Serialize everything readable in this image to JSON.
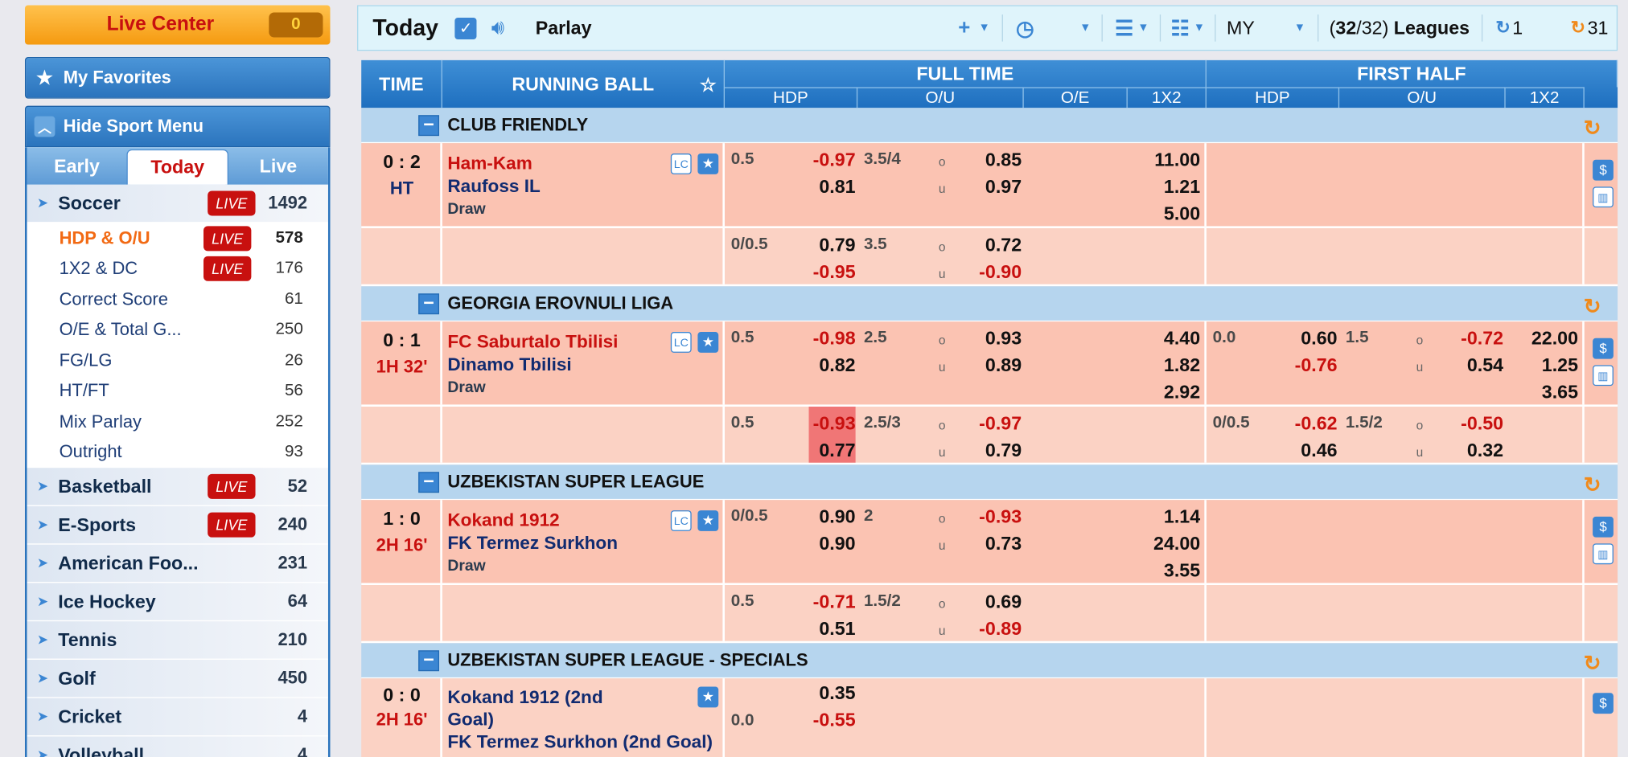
{
  "live_center": {
    "label": "Live Center",
    "count": "0"
  },
  "favorites": {
    "label": "My Favorites"
  },
  "hide_menu": {
    "label": "Hide Sport Menu"
  },
  "tabs": [
    "Early",
    "Today",
    "Live"
  ],
  "live_badge": "LIVE",
  "soccer": {
    "name": "Soccer",
    "count": "1492"
  },
  "subs": [
    {
      "name": "HDP & O/U",
      "count": "578",
      "live": true
    },
    {
      "name": "1X2 & DC",
      "count": "176",
      "live": true
    },
    {
      "name": "Correct Score",
      "count": "61"
    },
    {
      "name": "O/E & Total G...",
      "count": "250"
    },
    {
      "name": "FG/LG",
      "count": "26"
    },
    {
      "name": "HT/FT",
      "count": "56"
    },
    {
      "name": "Mix Parlay",
      "count": "252"
    },
    {
      "name": "Outright",
      "count": "93"
    }
  ],
  "sports": [
    {
      "name": "Basketball",
      "count": "52",
      "live": true
    },
    {
      "name": "E-Sports",
      "count": "240",
      "live": true
    },
    {
      "name": "American Foo...",
      "count": "231"
    },
    {
      "name": "Ice Hockey",
      "count": "64"
    },
    {
      "name": "Tennis",
      "count": "210"
    },
    {
      "name": "Golf",
      "count": "450"
    },
    {
      "name": "Cricket",
      "count": "4"
    },
    {
      "name": "Volleyball",
      "count": "4"
    }
  ],
  "topbar": {
    "title": "Today",
    "parlay": "Parlay",
    "odds_type": "MY",
    "leagues_selected": "32",
    "leagues_total": "/32)",
    "leagues_label": "Leagues",
    "refresh1": "1",
    "refresh2": "31"
  },
  "grid_header": {
    "time": "TIME",
    "running": "RUNNING BALL",
    "full_time": "FULL TIME",
    "first_half": "FIRST HALF",
    "hdp": "HDP",
    "ou": "O/U",
    "oe": "O/E",
    "x12": "1X2"
  },
  "leagues": [
    {
      "name": "CLUB FRIENDLY"
    },
    {
      "name": "GEORGIA EROVNULI LIGA"
    },
    {
      "name": "UZBEKISTAN SUPER LEAGUE"
    },
    {
      "name": "UZBEKISTAN SUPER LEAGUE - SPECIALS"
    }
  ],
  "matches": [
    {
      "score": "0 : 2",
      "time": "HT",
      "home": "Ham-Kam",
      "away": "Raufoss IL",
      "draw": "Draw",
      "ft_hdp": "0.5",
      "ft_hdp_h": "-0.97",
      "ft_hdp_a": "0.81",
      "ft_ou": "3.5/4",
      "ft_o": "0.85",
      "ft_u": "0.97",
      "x1": "11.00",
      "x2": "1.21",
      "xd": "5.00",
      "alt": {
        "hdp": "0/0.5",
        "h": "0.79",
        "a": "-0.95",
        "ou": "3.5",
        "o": "0.72",
        "u": "-0.90"
      }
    },
    {
      "score": "0 : 1",
      "time": "1H 32'",
      "home": "FC Saburtalo Tbilisi",
      "away": "Dinamo Tbilisi",
      "draw": "Draw",
      "ft_hdp": "0.5",
      "ft_hdp_h": "-0.98",
      "ft_hdp_a": "0.82",
      "ft_ou": "2.5",
      "ft_o": "0.93",
      "ft_u": "0.89",
      "x1": "4.40",
      "x2": "1.82",
      "xd": "2.92",
      "fh_hdp": "0.0",
      "fh_h": "0.60",
      "fh_a": "-0.76",
      "fh_ou": "1.5",
      "fh_o": "-0.72",
      "fh_u": "0.54",
      "fx1": "22.00",
      "fx2": "1.25",
      "fxd": "3.65",
      "alt": {
        "hdp": "0.5",
        "h": "-0.93",
        "a": "0.77",
        "ou": "2.5/3",
        "o": "-0.97",
        "u": "0.79",
        "fhdp": "0/0.5",
        "fh": "-0.62",
        "fa": "0.46",
        "fou": "1.5/2",
        "fo": "-0.50",
        "fu": "0.32"
      }
    },
    {
      "score": "1 : 0",
      "time": "2H 16'",
      "home": "Kokand 1912",
      "away": "FK Termez Surkhon",
      "draw": "Draw",
      "ft_hdp": "0/0.5",
      "ft_hdp_h": "0.90",
      "ft_hdp_a": "0.90",
      "ft_ou": "2",
      "ft_o": "-0.93",
      "ft_u": "0.73",
      "x1": "1.14",
      "x2": "24.00",
      "xd": "3.55",
      "alt": {
        "hdp": "0.5",
        "h": "-0.71",
        "a": "0.51",
        "ou": "1.5/2",
        "o": "0.69",
        "u": "-0.89"
      }
    },
    {
      "score": "0 : 0",
      "time": "2H 16'",
      "home": "Kokand 1912 (2nd",
      "home2": "Goal)",
      "away": "FK Termez Surkhon (2nd Goal)",
      "hdp": "0.0",
      "h": "0.35",
      "a": "-0.55"
    }
  ],
  "ou_o": "o",
  "ou_u": "u"
}
